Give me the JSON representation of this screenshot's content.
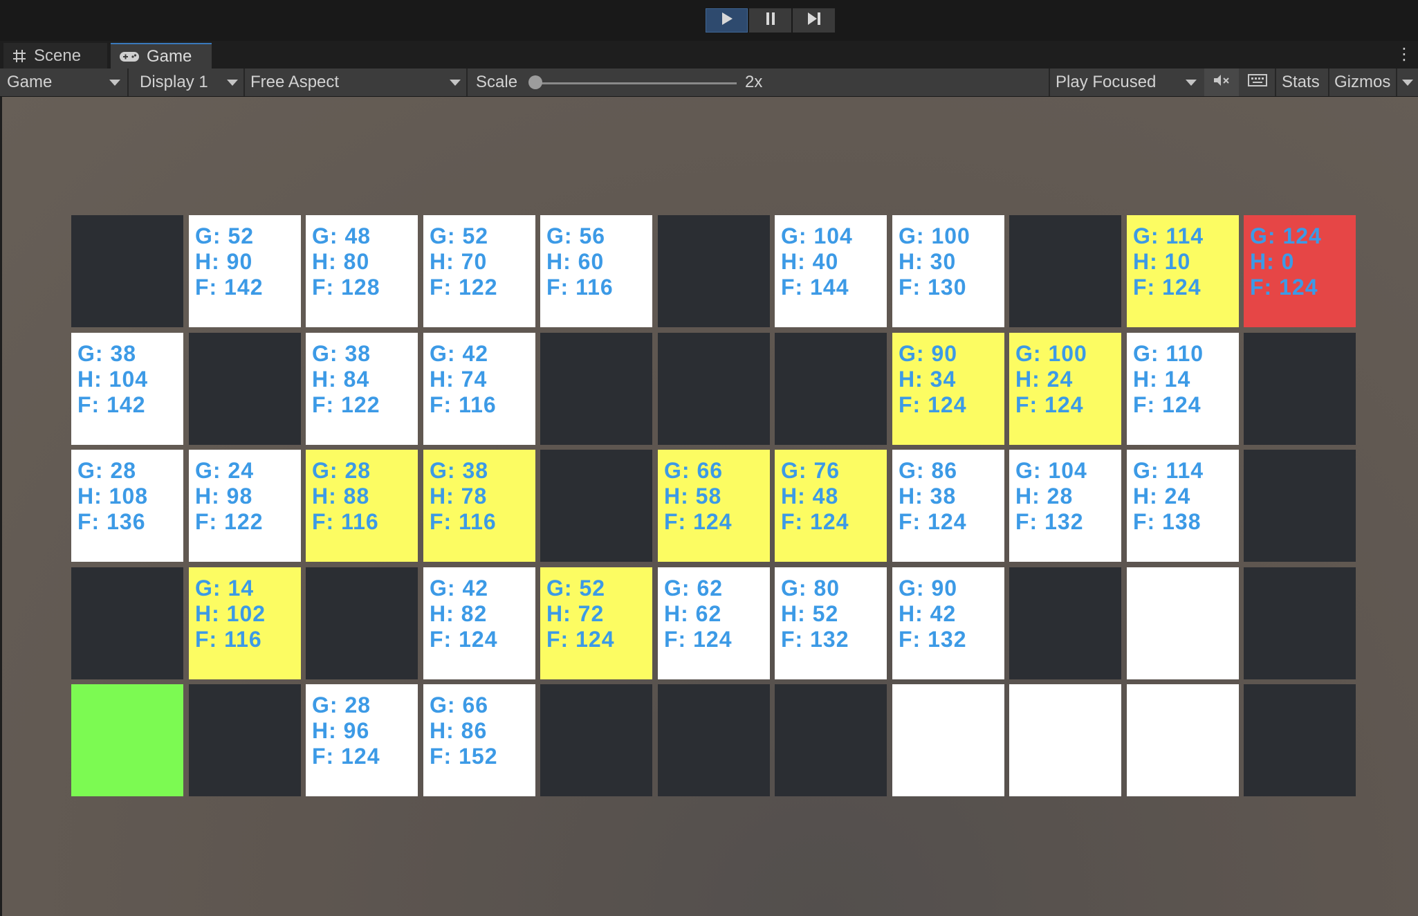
{
  "tabs": {
    "scene_label": "Scene",
    "game_label": "Game"
  },
  "toolbar": {
    "view_dropdown": "Game",
    "display_dropdown": "Display 1",
    "aspect_dropdown": "Free Aspect",
    "scale_label": "Scale",
    "scale_value": "2x",
    "play_mode_dropdown": "Play Focused",
    "stats_label": "Stats",
    "gizmos_label": "Gizmos"
  },
  "colors": {
    "wall": "#2b2e33",
    "open": "#ffffff",
    "path": "#fcfc62",
    "start": "#7cfa52",
    "goal": "#e64646",
    "cost_text": "#3c9ae6"
  },
  "grid": {
    "rows": [
      [
        {
          "t": "wall"
        },
        {
          "t": "open",
          "g": "52",
          "h": "90",
          "f": "142"
        },
        {
          "t": "open",
          "g": "48",
          "h": "80",
          "f": "128"
        },
        {
          "t": "open",
          "g": "52",
          "h": "70",
          "f": "122"
        },
        {
          "t": "open",
          "g": "56",
          "h": "60",
          "f": "116"
        },
        {
          "t": "wall"
        },
        {
          "t": "open",
          "g": "104",
          "h": "40",
          "f": "144"
        },
        {
          "t": "open",
          "g": "100",
          "h": "30",
          "f": "130"
        },
        {
          "t": "wall"
        },
        {
          "t": "path",
          "g": "114",
          "h": "10",
          "f": "124"
        },
        {
          "t": "goal",
          "g": "124",
          "h": "0",
          "f": "124"
        }
      ],
      [
        {
          "t": "open",
          "g": "38",
          "h": "104",
          "f": "142"
        },
        {
          "t": "wall"
        },
        {
          "t": "open",
          "g": "38",
          "h": "84",
          "f": "122"
        },
        {
          "t": "open",
          "g": "42",
          "h": "74",
          "f": "116"
        },
        {
          "t": "wall"
        },
        {
          "t": "wall"
        },
        {
          "t": "wall"
        },
        {
          "t": "path",
          "g": "90",
          "h": "34",
          "f": "124"
        },
        {
          "t": "path",
          "g": "100",
          "h": "24",
          "f": "124"
        },
        {
          "t": "open",
          "g": "110",
          "h": "14",
          "f": "124"
        },
        {
          "t": "wall"
        }
      ],
      [
        {
          "t": "open",
          "g": "28",
          "h": "108",
          "f": "136"
        },
        {
          "t": "open",
          "g": "24",
          "h": "98",
          "f": "122"
        },
        {
          "t": "path",
          "g": "28",
          "h": "88",
          "f": "116"
        },
        {
          "t": "path",
          "g": "38",
          "h": "78",
          "f": "116"
        },
        {
          "t": "wall"
        },
        {
          "t": "path",
          "g": "66",
          "h": "58",
          "f": "124"
        },
        {
          "t": "path",
          "g": "76",
          "h": "48",
          "f": "124"
        },
        {
          "t": "open",
          "g": "86",
          "h": "38",
          "f": "124"
        },
        {
          "t": "open",
          "g": "104",
          "h": "28",
          "f": "132"
        },
        {
          "t": "open",
          "g": "114",
          "h": "24",
          "f": "138"
        },
        {
          "t": "wall"
        }
      ],
      [
        {
          "t": "wall"
        },
        {
          "t": "path",
          "g": "14",
          "h": "102",
          "f": "116"
        },
        {
          "t": "wall"
        },
        {
          "t": "open",
          "g": "42",
          "h": "82",
          "f": "124"
        },
        {
          "t": "path",
          "g": "52",
          "h": "72",
          "f": "124"
        },
        {
          "t": "open",
          "g": "62",
          "h": "62",
          "f": "124"
        },
        {
          "t": "open",
          "g": "80",
          "h": "52",
          "f": "132"
        },
        {
          "t": "open",
          "g": "90",
          "h": "42",
          "f": "132"
        },
        {
          "t": "wall"
        },
        {
          "t": "open"
        },
        {
          "t": "wall"
        }
      ],
      [
        {
          "t": "start"
        },
        {
          "t": "wall"
        },
        {
          "t": "open",
          "g": "28",
          "h": "96",
          "f": "124"
        },
        {
          "t": "open",
          "g": "66",
          "h": "86",
          "f": "152"
        },
        {
          "t": "wall"
        },
        {
          "t": "wall"
        },
        {
          "t": "wall"
        },
        {
          "t": "open"
        },
        {
          "t": "open"
        },
        {
          "t": "open"
        },
        {
          "t": "wall"
        }
      ]
    ]
  }
}
